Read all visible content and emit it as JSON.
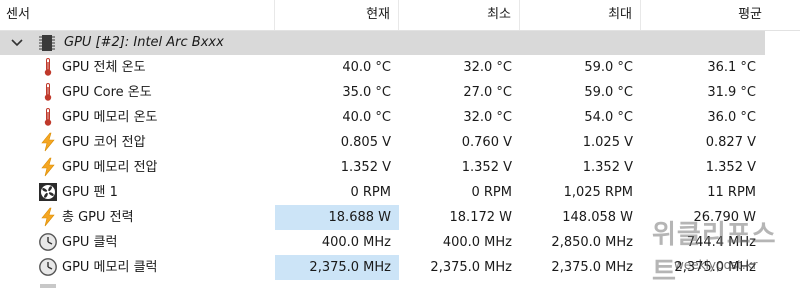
{
  "header": {
    "col_sensor": "센서",
    "col_current": "현재",
    "col_min": "최소",
    "col_max": "최대",
    "col_avg": "평균"
  },
  "group": {
    "title": "GPU [#2]: Intel Arc Bxxx",
    "expanded": true,
    "icon": "chip-icon"
  },
  "rows": [
    {
      "icon": "thermometer-icon",
      "label": "GPU 전체 온도",
      "current": "40.0 °C",
      "min": "32.0 °C",
      "max": "59.0 °C",
      "avg": "36.1 °C"
    },
    {
      "icon": "thermometer-icon",
      "label": "GPU Core 온도",
      "current": "35.0 °C",
      "min": "27.0 °C",
      "max": "59.0 °C",
      "avg": "31.9 °C"
    },
    {
      "icon": "thermometer-icon",
      "label": "GPU 메모리 온도",
      "current": "40.0 °C",
      "min": "32.0 °C",
      "max": "54.0 °C",
      "avg": "36.0 °C"
    },
    {
      "icon": "lightning-icon",
      "label": "GPU 코어 전압",
      "current": "0.805 V",
      "min": "0.760 V",
      "max": "1.025 V",
      "avg": "0.827 V"
    },
    {
      "icon": "lightning-icon",
      "label": "GPU 메모리 전압",
      "current": "1.352 V",
      "min": "1.352 V",
      "max": "1.352 V",
      "avg": "1.352 V"
    },
    {
      "icon": "fan-icon",
      "label": "GPU 팬 1",
      "current": "0 RPM",
      "min": "0 RPM",
      "max": "1,025 RPM",
      "avg": "11 RPM"
    },
    {
      "icon": "lightning-icon",
      "label": "총 GPU 전력",
      "current": "18.688 W",
      "min": "18.172 W",
      "max": "148.058 W",
      "avg": "26.790 W",
      "highlight": true
    },
    {
      "icon": "clock-icon",
      "label": "GPU 클럭",
      "current": "400.0 MHz",
      "min": "400.0 MHz",
      "max": "2,850.0 MHz",
      "avg": "744.4 MHz"
    },
    {
      "icon": "clock-icon",
      "label": "GPU 메모리 클럭",
      "current": "2,375.0 MHz",
      "min": "2,375.0 MHz",
      "max": "2,375.0 MHz",
      "avg": "2,375.0 MHz",
      "highlight": true
    }
  ],
  "colors": {
    "group_bg": "#d9d9d9",
    "highlight": "#cce4f7",
    "thermometer": "#c0392b",
    "lightning": "#f5a623"
  },
  "watermark": {
    "logo": "위클리포스트",
    "url": "weeklypost.kr"
  }
}
